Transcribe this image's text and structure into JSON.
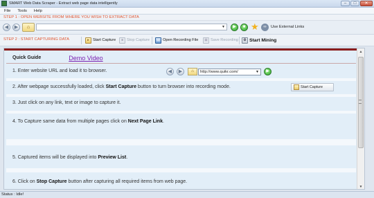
{
  "window": {
    "title": "SMART Web Data Scraper - Extract web page data intelligently",
    "buttons": {
      "minimize": "–",
      "maximize": "□",
      "close": "✕"
    }
  },
  "menu": {
    "items": [
      "File",
      "Tools",
      "Help"
    ]
  },
  "step1": {
    "label": "STEP 1 : OPEN WEBSITE FROM WHERE YOU WISH TO EXTRACT DATA",
    "url_value": "",
    "external_links_label": "Use External Links"
  },
  "step2": {
    "label": "STEP 2 : START CAPTURING DATA",
    "buttons": {
      "start_capture": "Start Capture",
      "stop_capture": "Stop Capture",
      "open_recording": "Open Recording File",
      "save_recording": "Save Recording",
      "start_mining": "Start Mining"
    }
  },
  "guide": {
    "tab_quick": "Quick Guide",
    "tab_video": "Demo Video",
    "demo_url": "http://www.quikr.com/",
    "demo_capture_label": "Start Capture",
    "items": [
      {
        "pre": "1. Enter website URL and load it to browser.",
        "bold": "",
        "post": ""
      },
      {
        "pre": "2. After webpage successfully loaded, click ",
        "bold": "Start Capture",
        "post": " button to turn browser into recording mode."
      },
      {
        "pre": "3. Just click on any link, text or image to capture it.",
        "bold": "",
        "post": ""
      },
      {
        "pre": "4. To Capture same data from multiple pages click on ",
        "bold": "Next Page Link",
        "post": "."
      },
      {
        "pre": "5. Captured items will be displayed into ",
        "bold": "Preview List",
        "post": "."
      },
      {
        "pre": "6. Click on ",
        "bold": "Stop Capture",
        "post": " button after capturing all required items from web page."
      }
    ]
  },
  "status": {
    "text": "Status : Idle!"
  },
  "colors": {
    "step_text": "#e0542f",
    "accent_red": "#8b1c1c",
    "guide_bg": "#e2eef8",
    "video_link": "#7a1fb0"
  }
}
